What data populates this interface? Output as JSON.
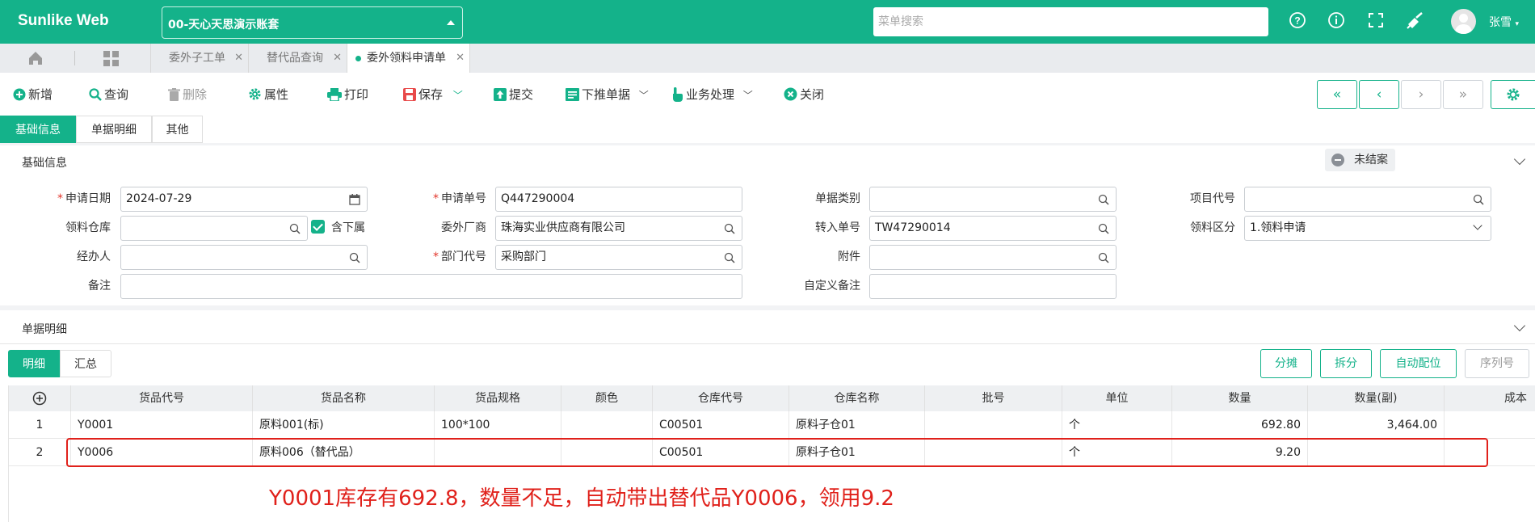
{
  "app": {
    "logo": "Sunlike Web",
    "account": "00-天心天思演示账套",
    "search_placeholder": "菜单搜索",
    "user": "张雪"
  },
  "tabs": [
    {
      "label": "委外子工单"
    },
    {
      "label": "替代品查询"
    },
    {
      "label": "委外领料申请单"
    }
  ],
  "toolbar": {
    "add": "新增",
    "query": "查询",
    "delete": "删除",
    "props": "属性",
    "print": "打印",
    "save": "保存",
    "submit": "提交",
    "push": "下推单据",
    "biz": "业务处理",
    "close": "关闭"
  },
  "subtabs": [
    "基础信息",
    "单据明细",
    "其他"
  ],
  "basic": {
    "title": "基础信息",
    "status": "未结案",
    "labels": {
      "apply_date": "申请日期",
      "apply_no": "申请单号",
      "doc_type": "单据类别",
      "project": "项目代号",
      "warehouse": "领料仓库",
      "include_sub": "含下属",
      "vendor": "委外厂商",
      "transfer_no": "转入单号",
      "category": "领料区分",
      "handler": "经办人",
      "dept": "部门代号",
      "attach": "附件",
      "remark": "备注",
      "custom_remark": "自定义备注"
    },
    "values": {
      "apply_date": "2024-07-29",
      "apply_no": "Q447290004",
      "vendor": "珠海实业供应商有限公司",
      "transfer_no": "TW47290014",
      "category": "1.领料申请",
      "dept": "采购部门"
    }
  },
  "detail": {
    "title": "单据明细",
    "tabs": [
      "明细",
      "汇总"
    ],
    "buttons": [
      "分摊",
      "拆分",
      "自动配位",
      "序列号"
    ],
    "columns": [
      "货品代号",
      "货品名称",
      "货品规格",
      "颜色",
      "仓库代号",
      "仓库名称",
      "批号",
      "单位",
      "数量",
      "数量(副)",
      "成本"
    ],
    "rows": [
      {
        "no": "1",
        "code": "Y0001",
        "name": "原料001(标)",
        "spec": "100*100",
        "color": "",
        "wh_code": "C00501",
        "wh_name": "原料子仓01",
        "batch": "",
        "unit": "个",
        "qty": "692.80",
        "qty2": "3,464.00",
        "cost": ""
      },
      {
        "no": "2",
        "code": "Y0006",
        "name": "原料006（替代品）",
        "spec": "",
        "color": "",
        "wh_code": "C00501",
        "wh_name": "原料子仓01",
        "batch": "",
        "unit": "个",
        "qty": "9.20",
        "qty2": "",
        "cost": ""
      }
    ]
  },
  "annotation": "Y0001库存有692.8，数量不足，自动带出替代品Y0006，领用9.2",
  "colors": {
    "brand": "#14b28a",
    "annotation": "#e0211b"
  }
}
